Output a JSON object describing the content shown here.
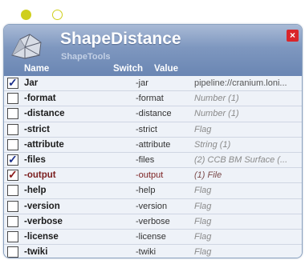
{
  "module": {
    "title": "ShapeDistance",
    "subtitle": "ShapeTools",
    "close_label": "×"
  },
  "columns": {
    "name": "Name",
    "switch": "Switch",
    "value": "Value"
  },
  "parameters": [
    {
      "name": "Jar",
      "switch": "-jar",
      "value": "pipeline://cranium.loni...",
      "checked": true,
      "check_color": "blue",
      "style": "link"
    },
    {
      "name": "-format",
      "switch": "-format",
      "value": "Number (1)",
      "checked": false
    },
    {
      "name": "-distance",
      "switch": "-distance",
      "value": "Number (1)",
      "checked": false
    },
    {
      "name": "-strict",
      "switch": "-strict",
      "value": "Flag",
      "checked": false
    },
    {
      "name": "-attribute",
      "switch": "-attribute",
      "value": "String (1)",
      "checked": false
    },
    {
      "name": "-files",
      "switch": "-files",
      "value": "(2) CCB BM Surface (...",
      "checked": true,
      "check_color": "blue"
    },
    {
      "name": "-output",
      "switch": "-output",
      "value": "(1) File",
      "checked": true,
      "check_color": "red",
      "style": "sel"
    },
    {
      "name": "-help",
      "switch": "-help",
      "value": "Flag",
      "checked": false
    },
    {
      "name": "-version",
      "switch": "-version",
      "value": "Flag",
      "checked": false
    },
    {
      "name": "-verbose",
      "switch": "-verbose",
      "value": "Flag",
      "checked": false
    },
    {
      "name": "-license",
      "switch": "-license",
      "value": "Flag",
      "checked": false
    },
    {
      "name": "-twiki",
      "switch": "-twiki",
      "value": "Flag",
      "checked": false
    }
  ]
}
